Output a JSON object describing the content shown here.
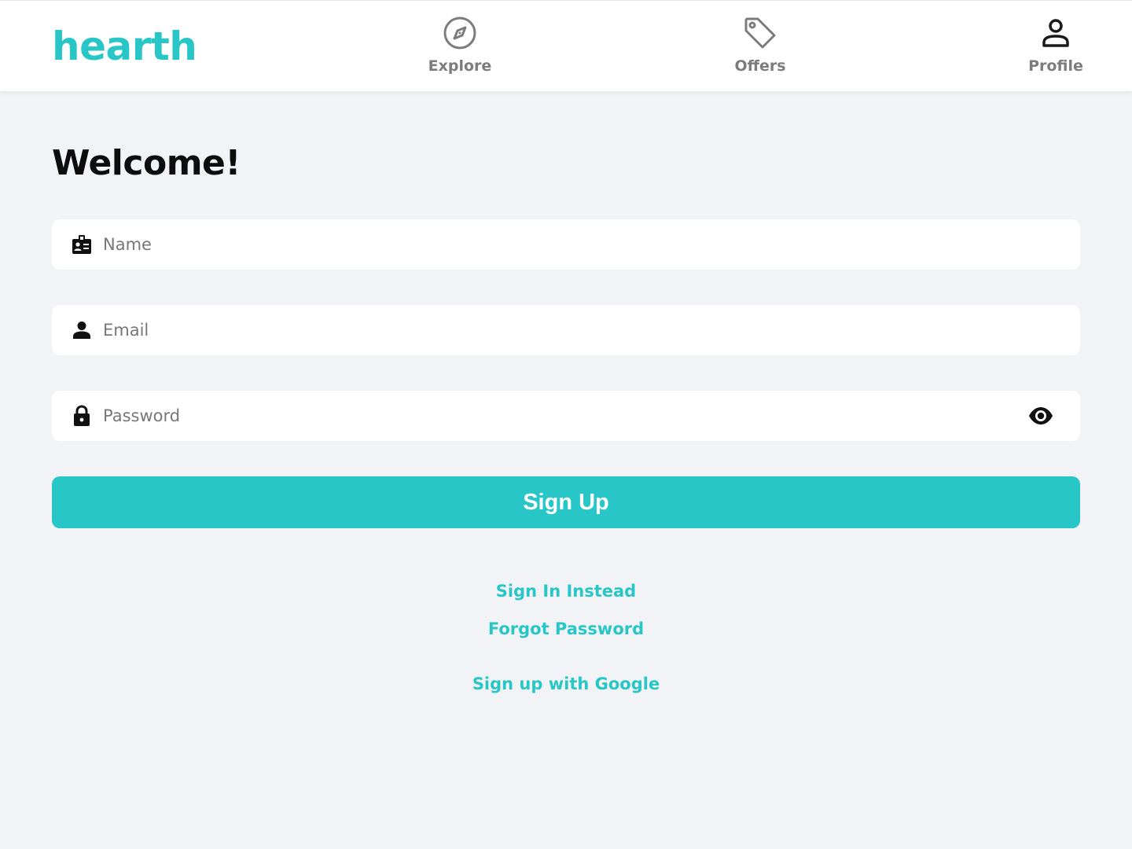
{
  "app": {
    "logo": "hearth",
    "accent_color": "#28c6c6"
  },
  "nav": {
    "items": [
      {
        "label": "Explore",
        "icon": "compass-icon"
      },
      {
        "label": "Offers",
        "icon": "tag-icon"
      },
      {
        "label": "Profile",
        "icon": "user-icon"
      }
    ]
  },
  "page": {
    "title": "Welcome!"
  },
  "form": {
    "name": {
      "placeholder": "Name",
      "value": "",
      "icon": "id-badge-icon"
    },
    "email": {
      "placeholder": "Email",
      "value": "",
      "icon": "person-icon"
    },
    "password": {
      "placeholder": "Password",
      "value": "",
      "icon": "lock-icon",
      "toggle_icon": "eye-icon"
    },
    "submit_label": "Sign Up"
  },
  "links": {
    "sign_in": "Sign In Instead",
    "forgot": "Forgot Password",
    "google": "Sign up with Google"
  }
}
